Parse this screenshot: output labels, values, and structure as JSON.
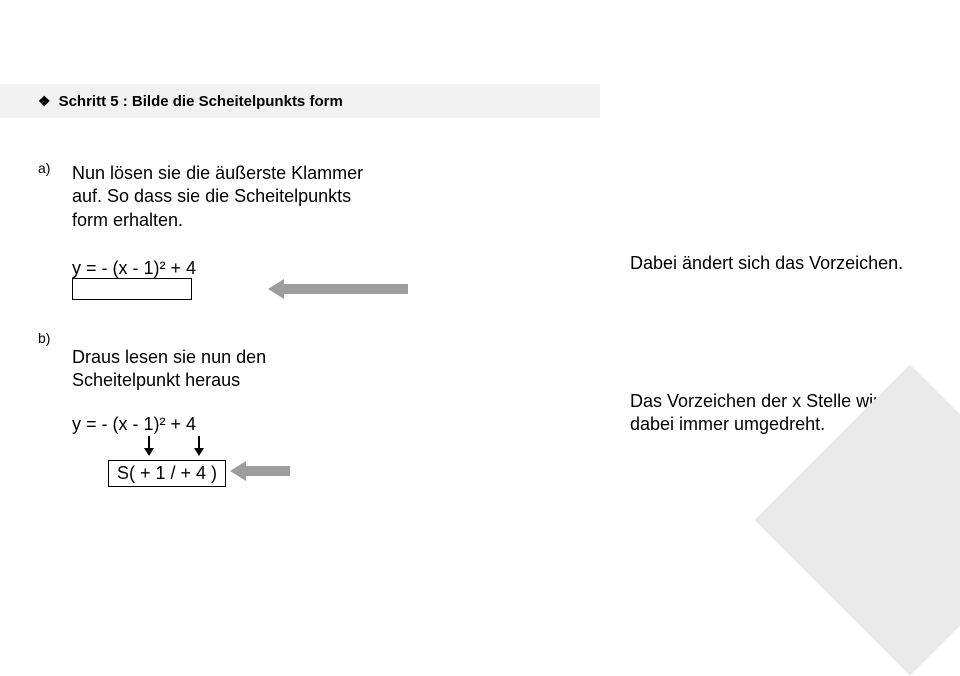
{
  "step": {
    "bullet": "❖",
    "title": "Schritt 5 : Bilde die Scheitelpunkts form"
  },
  "a": {
    "label": "a)",
    "text": "Nun lösen sie die äußerste Klammer auf. So dass sie die Scheitelpunkts form erhalten.",
    "equation": "y = - (x - 1)² + 4",
    "note": "Dabei ändert sich das Vorzeichen."
  },
  "b": {
    "label": "b)",
    "text": "Draus lesen sie nun den Scheitelpunkt heraus",
    "equation": "y = - (x - 1)² + 4",
    "result": "S( + 1 / + 4 )",
    "note": "Das Vorzeichen der x Stelle wird dabei immer umgedreht."
  }
}
